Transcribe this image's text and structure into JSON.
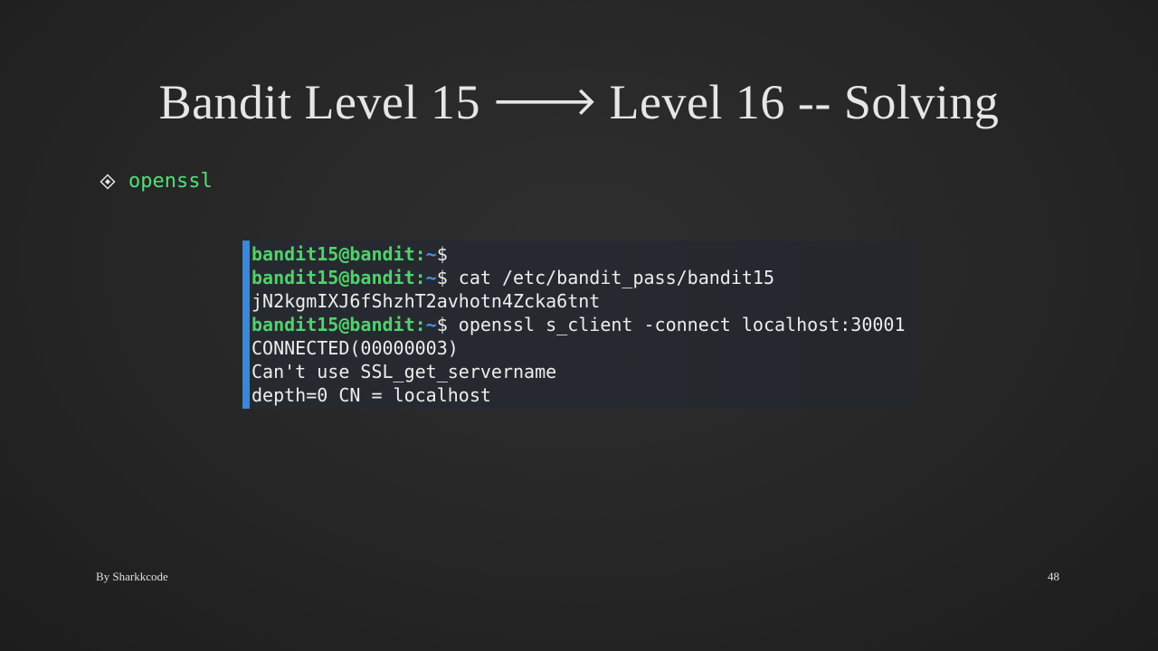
{
  "slide": {
    "title_left": "Bandit Level 15",
    "title_arrow": "🡒",
    "title_right": "Level 16 -- Solving",
    "bullet": {
      "icon": "diamond-bullet-icon",
      "text": "openssl",
      "color": "#4fe07a"
    },
    "terminal": {
      "accent_color": "#3a87d6",
      "prompt": {
        "user_host": "bandit15@bandit",
        "colon": ":",
        "path": "~",
        "dollar": "$"
      },
      "lines": [
        {
          "type": "prompt",
          "command": ""
        },
        {
          "type": "prompt",
          "command": " cat /etc/bandit_pass/bandit15"
        },
        {
          "type": "output",
          "text": "jN2kgmIXJ6fShzhT2avhotn4Zcka6tnt"
        },
        {
          "type": "prompt",
          "command": " openssl s_client -connect localhost:30001"
        },
        {
          "type": "output",
          "text": "CONNECTED(00000003)"
        },
        {
          "type": "output",
          "text": "Can't use SSL_get_servername"
        },
        {
          "type": "output",
          "text": "depth=0 CN = localhost"
        }
      ]
    },
    "footer": {
      "author": "By Sharkkcode",
      "page_number": "48"
    }
  }
}
